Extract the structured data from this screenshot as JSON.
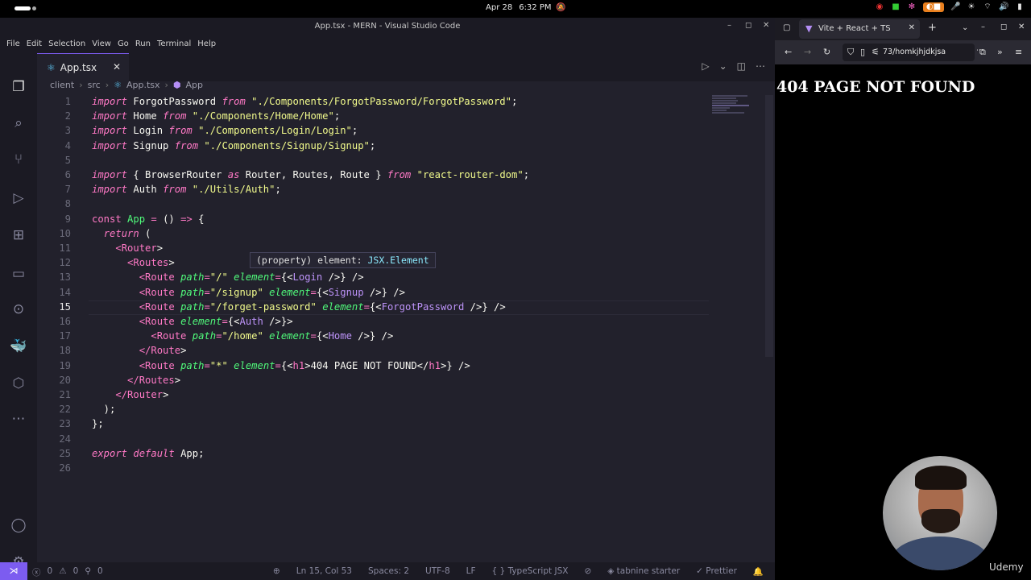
{
  "system": {
    "date": "Apr 28",
    "time": "6:32 PM"
  },
  "vscode": {
    "window_title": "App.tsx - MERN - Visual Studio Code",
    "menu": [
      "File",
      "Edit",
      "Selection",
      "View",
      "Go",
      "Run",
      "Terminal",
      "Help"
    ],
    "tab": {
      "label": "App.tsx",
      "close": "✕"
    },
    "breadcrumb": [
      "client",
      "src",
      "App.tsx",
      "App"
    ],
    "hover_tooltip": {
      "prefix": "(property) element: ",
      "type": "JSX.Element"
    },
    "current_line": 15,
    "code_lines": [
      [
        [
          "kw",
          "import"
        ],
        [
          "id",
          " ForgotPassword "
        ],
        [
          "kw",
          "from"
        ],
        [
          "str",
          " \"./Components/ForgotPassword/ForgotPassword\""
        ],
        [
          "punc",
          ";"
        ]
      ],
      [
        [
          "kw",
          "import"
        ],
        [
          "id",
          " Home "
        ],
        [
          "kw",
          "from"
        ],
        [
          "str",
          " \"./Components/Home/Home\""
        ],
        [
          "punc",
          ";"
        ]
      ],
      [
        [
          "kw",
          "import"
        ],
        [
          "id",
          " Login "
        ],
        [
          "kw",
          "from"
        ],
        [
          "str",
          " \"./Components/Login/Login\""
        ],
        [
          "punc",
          ";"
        ]
      ],
      [
        [
          "kw",
          "import"
        ],
        [
          "id",
          " Signup "
        ],
        [
          "kw",
          "from"
        ],
        [
          "str",
          " \"./Components/Signup/Signup\""
        ],
        [
          "punc",
          ";"
        ]
      ],
      [],
      [
        [
          "kw",
          "import"
        ],
        [
          "punc",
          " { "
        ],
        [
          "id",
          "BrowserRouter "
        ],
        [
          "kw",
          "as"
        ],
        [
          "id",
          " Router, Routes, Route "
        ],
        [
          "punc",
          "} "
        ],
        [
          "kw",
          "from"
        ],
        [
          "str",
          " \"react-router-dom\""
        ],
        [
          "punc",
          ";"
        ]
      ],
      [
        [
          "kw",
          "import"
        ],
        [
          "id",
          " Auth "
        ],
        [
          "kw",
          "from"
        ],
        [
          "str",
          " \"./Utils/Auth\""
        ],
        [
          "punc",
          ";"
        ]
      ],
      [],
      [
        [
          "kw2",
          "const "
        ],
        [
          "fn",
          "App "
        ],
        [
          "kw2",
          "= "
        ],
        [
          "punc",
          "() "
        ],
        [
          "kw2",
          "=> "
        ],
        [
          "punc",
          "{"
        ]
      ],
      [
        [
          "punc",
          "  "
        ],
        [
          "kw",
          "return"
        ],
        [
          "punc",
          " ("
        ]
      ],
      [
        [
          "punc",
          "    "
        ],
        [
          "tag",
          "<Router"
        ],
        [
          "punc",
          ">"
        ]
      ],
      [
        [
          "punc",
          "      "
        ],
        [
          "tag",
          "<Routes"
        ],
        [
          "punc",
          ">"
        ]
      ],
      [
        [
          "punc",
          "        "
        ],
        [
          "tag",
          "<Route "
        ],
        [
          "attr",
          "path"
        ],
        [
          "kw2",
          "="
        ],
        [
          "str",
          "\"/\" "
        ],
        [
          "attr",
          "element"
        ],
        [
          "kw2",
          "="
        ],
        [
          "punc",
          "{<"
        ],
        [
          "comp",
          "Login"
        ],
        [
          "punc",
          " />} />"
        ]
      ],
      [
        [
          "punc",
          "        "
        ],
        [
          "tag",
          "<Route "
        ],
        [
          "attr",
          "path"
        ],
        [
          "kw2",
          "="
        ],
        [
          "str",
          "\"/signup\" "
        ],
        [
          "attr",
          "element"
        ],
        [
          "kw2",
          "="
        ],
        [
          "punc",
          "{<"
        ],
        [
          "comp",
          "Signup"
        ],
        [
          "punc",
          " />} />"
        ]
      ],
      [
        [
          "punc",
          "        "
        ],
        [
          "tag",
          "<Route "
        ],
        [
          "attr",
          "path"
        ],
        [
          "kw2",
          "="
        ],
        [
          "str",
          "\"/forget-password\" "
        ],
        [
          "attr",
          "element"
        ],
        [
          "kw2",
          "="
        ],
        [
          "punc",
          "{<"
        ],
        [
          "comp",
          "ForgotPassword"
        ],
        [
          "punc",
          " />} />"
        ]
      ],
      [
        [
          "punc",
          "        "
        ],
        [
          "tag",
          "<Route "
        ],
        [
          "attr",
          "element"
        ],
        [
          "kw2",
          "="
        ],
        [
          "punc",
          "{<"
        ],
        [
          "comp",
          "Auth"
        ],
        [
          "punc",
          " />}>"
        ]
      ],
      [
        [
          "punc",
          "          "
        ],
        [
          "tag",
          "<Route "
        ],
        [
          "attr",
          "path"
        ],
        [
          "kw2",
          "="
        ],
        [
          "str",
          "\"/home\" "
        ],
        [
          "attr",
          "element"
        ],
        [
          "kw2",
          "="
        ],
        [
          "punc",
          "{<"
        ],
        [
          "comp",
          "Home"
        ],
        [
          "punc",
          " />} />"
        ]
      ],
      [
        [
          "punc",
          "        "
        ],
        [
          "tag",
          "</Route"
        ],
        [
          "punc",
          ">"
        ]
      ],
      [
        [
          "punc",
          "        "
        ],
        [
          "tag",
          "<Route "
        ],
        [
          "attr",
          "path"
        ],
        [
          "kw2",
          "="
        ],
        [
          "str",
          "\"*\" "
        ],
        [
          "attr",
          "element"
        ],
        [
          "kw2",
          "="
        ],
        [
          "punc",
          "{<"
        ],
        [
          "tag",
          "h1"
        ],
        [
          "punc",
          ">"
        ],
        [
          "jsxtext",
          "404 PAGE NOT FOUND"
        ],
        [
          "punc",
          "</"
        ],
        [
          "tag",
          "h1"
        ],
        [
          "punc",
          ">} />"
        ]
      ],
      [
        [
          "punc",
          "      "
        ],
        [
          "tag",
          "</Routes"
        ],
        [
          "punc",
          ">"
        ]
      ],
      [
        [
          "punc",
          "    "
        ],
        [
          "tag",
          "</Router"
        ],
        [
          "punc",
          ">"
        ]
      ],
      [
        [
          "punc",
          "  );"
        ]
      ],
      [
        [
          "punc",
          "};"
        ]
      ],
      [],
      [
        [
          "kw",
          "export"
        ],
        [
          "punc",
          " "
        ],
        [
          "kw",
          "default"
        ],
        [
          "id",
          " App"
        ],
        [
          "punc",
          ";"
        ]
      ],
      []
    ],
    "status": {
      "errors": "0",
      "warnings": "0",
      "ports": "0",
      "position": "Ln 15, Col 53",
      "spaces": "Spaces: 2",
      "encoding": "UTF-8",
      "eol": "LF",
      "language": "TypeScript JSX",
      "tabnine": "tabnine starter",
      "prettier": "Prettier"
    },
    "accounts_badge": "1"
  },
  "browser": {
    "tab_title": "Vite + React + TS",
    "new_tab": "+",
    "url": "73/homkjhjdkjsa",
    "page_heading": "404 PAGE NOT FOUND"
  },
  "watermark": "Udemy",
  "colors": {
    "accent": "#7c5cf0",
    "background": "#22212c",
    "keyword": "#ff79c6",
    "string": "#f1fa8c"
  }
}
